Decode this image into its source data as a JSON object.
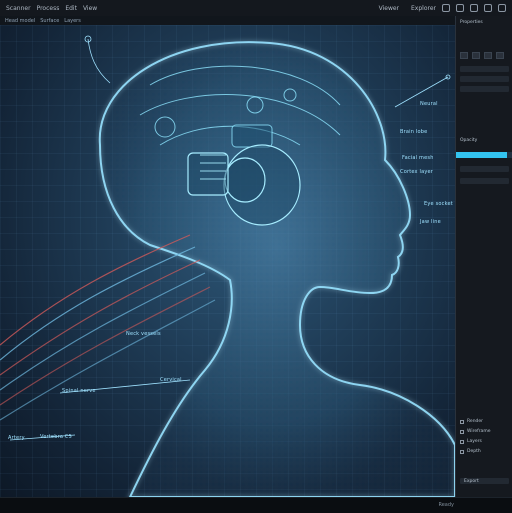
{
  "menubar": {
    "items": [
      "Scanner",
      "Process",
      "Edit",
      "View"
    ],
    "right_items": [
      "Viewer",
      "Explorer"
    ],
    "icons": [
      "layers-icon",
      "settings-icon",
      "gear-icon",
      "pin-icon",
      "close-icon"
    ]
  },
  "tabs": [
    "Head model",
    "Surface",
    "Layers"
  ],
  "viewport": {
    "annotations": [
      {
        "text": "Neural",
        "id": "ann-neural"
      },
      {
        "text": "Brain lobe",
        "id": "ann-brain-lobe"
      },
      {
        "text": "Facial mesh",
        "id": "ann-facial-mesh"
      },
      {
        "text": "Cortex layer",
        "id": "ann-cortex"
      },
      {
        "text": "Eye socket",
        "id": "ann-eye-socket"
      },
      {
        "text": "Jaw line",
        "id": "ann-jaw"
      },
      {
        "text": "Neck vessels",
        "id": "ann-neck-vessels"
      },
      {
        "text": "Spinal nerve",
        "id": "ann-spinal"
      },
      {
        "text": "Cervical",
        "id": "ann-cervical"
      },
      {
        "text": "Vertebra C5",
        "id": "ann-vertebra"
      },
      {
        "text": "Artery",
        "id": "ann-artery"
      }
    ]
  },
  "panel": {
    "top_label": "Properties",
    "section_label": "Opacity",
    "slider_value": 0.9,
    "bottom_labels": [
      "Render",
      "Wireframe",
      "Layers",
      "Depth",
      "Export"
    ]
  },
  "status": {
    "text": "Ready"
  },
  "colors": {
    "accent": "#33c4f0",
    "mesh": "#7fd6ff",
    "vessel": "#d05a5a"
  }
}
